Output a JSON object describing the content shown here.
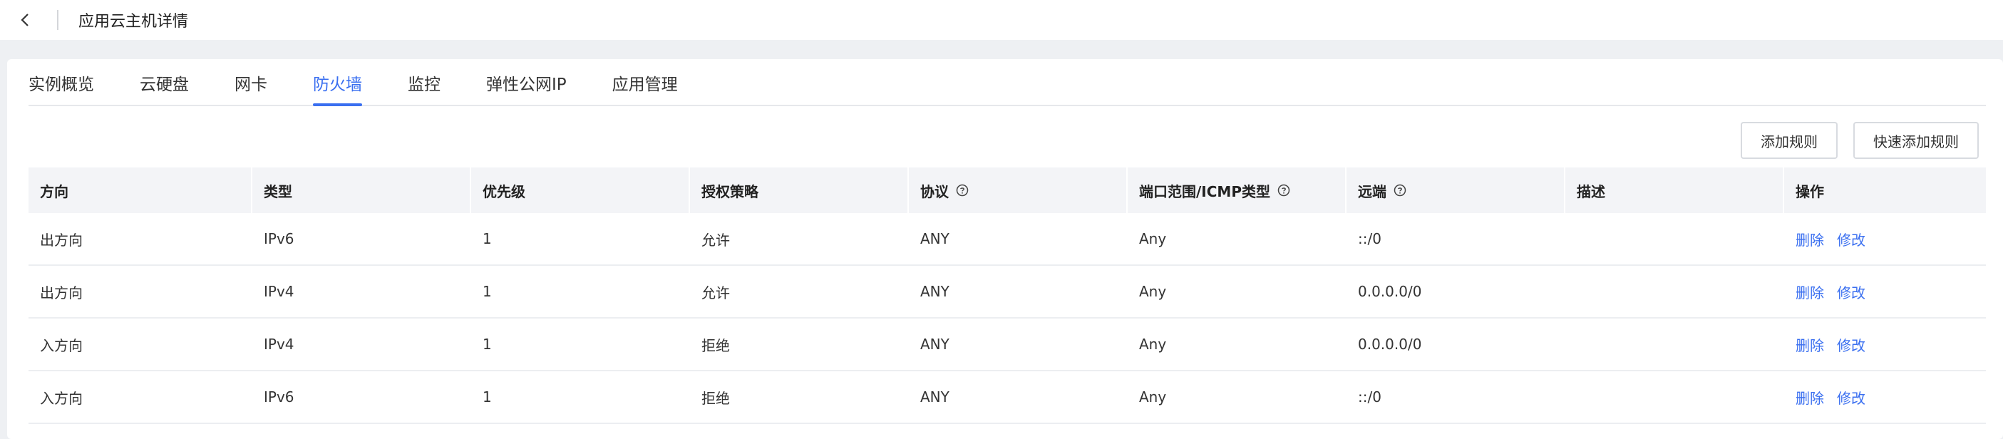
{
  "header": {
    "title": "应用云主机详情"
  },
  "tabs": [
    {
      "label": "实例概览",
      "active": false
    },
    {
      "label": "云硬盘",
      "active": false
    },
    {
      "label": "网卡",
      "active": false
    },
    {
      "label": "防火墙",
      "active": true
    },
    {
      "label": "监控",
      "active": false
    },
    {
      "label": "弹性公网IP",
      "active": false
    },
    {
      "label": "应用管理",
      "active": false
    }
  ],
  "toolbar": {
    "add_rule": "添加规则",
    "quick_add_rule": "快速添加规则"
  },
  "table": {
    "columns": [
      "方向",
      "类型",
      "优先级",
      "授权策略",
      "协议",
      "端口范围/ICMP类型",
      "远端",
      "描述",
      "操作"
    ],
    "rows": [
      {
        "direction": "出方向",
        "type": "IPv6",
        "priority": "1",
        "policy": "允许",
        "protocol": "ANY",
        "port": "Any",
        "remote": "::/0",
        "desc": "",
        "delete": "删除",
        "edit": "修改"
      },
      {
        "direction": "出方向",
        "type": "IPv4",
        "priority": "1",
        "policy": "允许",
        "protocol": "ANY",
        "port": "Any",
        "remote": "0.0.0.0/0",
        "desc": "",
        "delete": "删除",
        "edit": "修改"
      },
      {
        "direction": "入方向",
        "type": "IPv4",
        "priority": "1",
        "policy": "拒绝",
        "protocol": "ANY",
        "port": "Any",
        "remote": "0.0.0.0/0",
        "desc": "",
        "delete": "删除",
        "edit": "修改"
      },
      {
        "direction": "入方向",
        "type": "IPv6",
        "priority": "1",
        "policy": "拒绝",
        "protocol": "ANY",
        "port": "Any",
        "remote": "::/0",
        "desc": "",
        "delete": "删除",
        "edit": "修改"
      }
    ]
  },
  "colors": {
    "accent": "#3a6ff0"
  }
}
